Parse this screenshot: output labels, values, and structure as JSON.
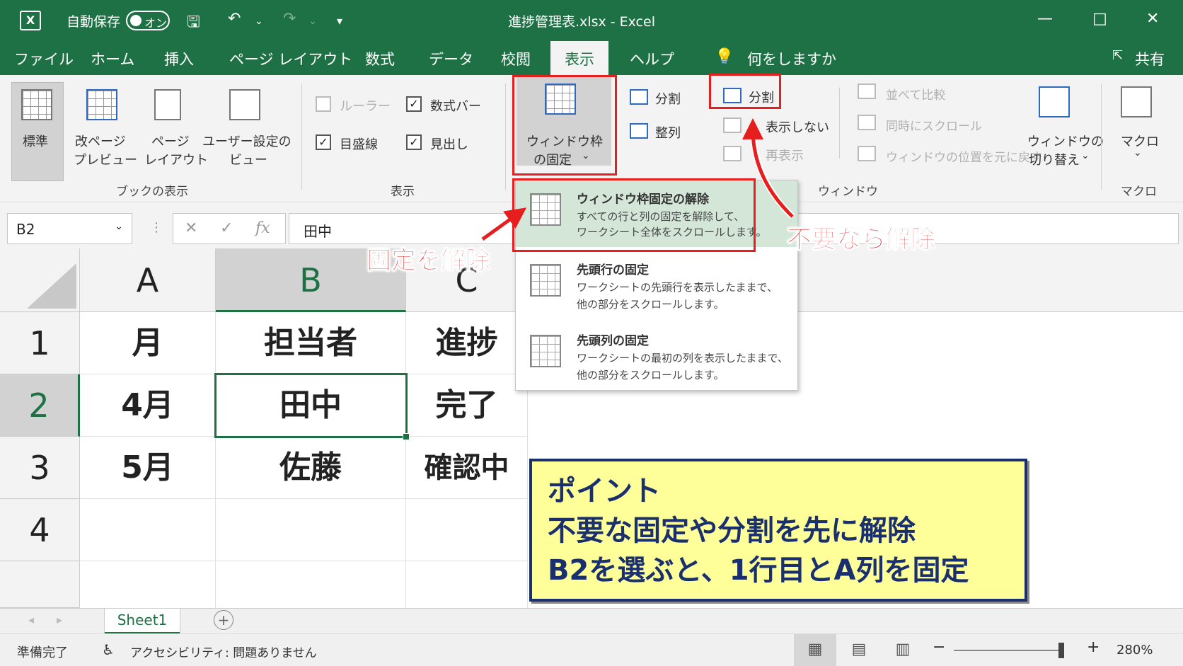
{
  "titlebar": {
    "autosave_label": "自動保存",
    "autosave_state": "オン",
    "document_title": "進捗管理表.xlsx - Excel"
  },
  "menu": {
    "tabs": [
      "ファイル",
      "ホーム",
      "挿入",
      "ページ レイアウト",
      "数式",
      "データ",
      "校閲",
      "表示",
      "ヘルプ"
    ],
    "active_tab": "表示",
    "tellme": "何をしますか",
    "share": "共有"
  },
  "ribbon": {
    "workbook_views": {
      "group_label": "ブックの表示",
      "normal": "標準",
      "page_break_1": "改ページ",
      "page_break_2": "プレビュー",
      "page_layout_1": "ページ",
      "page_layout_2": "レイアウト",
      "custom_1": "ユーザー設定の",
      "custom_2": "ビュー"
    },
    "show": {
      "group_label": "表示",
      "ruler": "ルーラー",
      "formula_bar": "数式バー",
      "gridlines": "目盛線",
      "headings": "見出し"
    },
    "window": {
      "group_label": "ウィンドウ",
      "freeze_1": "ウィンドウ枠",
      "freeze_2": "の固定",
      "new_window": "分割",
      "arrange": "整列",
      "split": "分割",
      "hide": "表示しない",
      "unhide": "再表示",
      "side_by_side": "並べて比較",
      "sync_scroll": "同時にスクロール",
      "reset_position": "ウィンドウの位置を元に戻す",
      "switch_1": "ウィンドウの",
      "switch_2": "切り替え"
    },
    "macros": {
      "group_label": "マクロ",
      "button": "マクロ"
    }
  },
  "formula_bar": {
    "name_box": "B2",
    "fx": "fx",
    "content": "田中"
  },
  "sheet": {
    "columns": [
      "A",
      "B",
      "C"
    ],
    "rows": [
      "1",
      "2",
      "3",
      "4"
    ],
    "cells": [
      [
        "月",
        "担当者",
        "進捗"
      ],
      [
        "4月",
        "田中",
        "完了"
      ],
      [
        "5月",
        "佐藤",
        "確認中"
      ],
      [
        "",
        "",
        ""
      ]
    ],
    "selected_cell": "B2"
  },
  "dropdown": {
    "items": [
      {
        "title": "ウィンドウ枠固定の解除",
        "desc1": "すべての行と列の固定を解除して、",
        "desc2": "ワークシート全体をスクロールします。"
      },
      {
        "title": "先頭行の固定",
        "desc1": "ワークシートの先頭行を表示したままで、",
        "desc2": "他の部分をスクロールします。"
      },
      {
        "title": "先頭列の固定",
        "desc1": "ワークシートの最初の列を表示したままで、",
        "desc2": "他の部分をスクロールします。"
      }
    ]
  },
  "annotations": {
    "unfreeze_label": "固定を解除",
    "remove_label": "不要なら解除",
    "point_title": "ポイント",
    "point_line1": "不要な固定や分割を先に解除",
    "point_line2": "B2を選ぶと、1行目とA列を固定"
  },
  "sheet_tabs": {
    "sheet1": "Sheet1"
  },
  "status": {
    "ready": "準備完了",
    "accessibility": "アクセシビリティ: 問題ありません",
    "zoom": "280%"
  },
  "colors": {
    "excel_green": "#1e7145",
    "annotation_red": "#e61e1e",
    "point_bg": "#ffff99",
    "point_border": "#1a2f6e",
    "highlight_item": "#d3e6d8"
  }
}
